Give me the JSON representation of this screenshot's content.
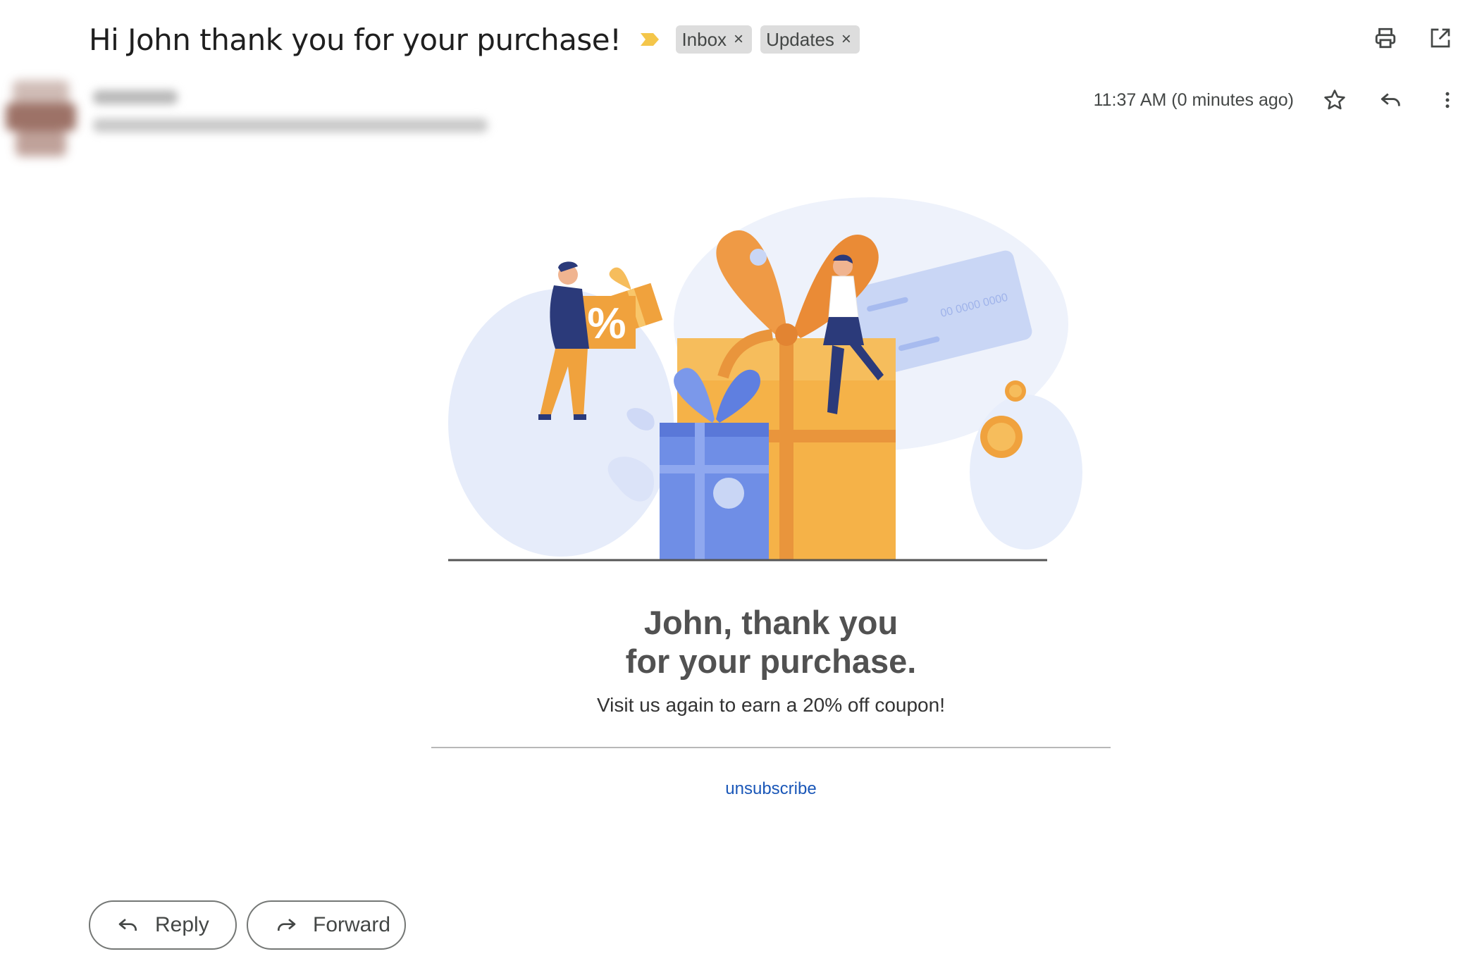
{
  "email": {
    "subject": "Hi John thank you for your purchase!",
    "labels": [
      {
        "name": "Inbox",
        "remove_glyph": "×"
      },
      {
        "name": "Updates",
        "remove_glyph": "×"
      }
    ],
    "timestamp": "11:37 AM (0 minutes ago)"
  },
  "icons": {
    "importance": "importance-marker-icon",
    "print": "print-icon",
    "open_new_window": "open-in-new-window-icon",
    "star": "star-icon",
    "reply": "reply-icon",
    "more": "more-vert-icon",
    "forward": "forward-icon"
  },
  "body": {
    "headline_line1": "John, thank you",
    "headline_line2": "for your purchase.",
    "subline": "Visit us again to earn a 20% off coupon!",
    "unsubscribe": "unsubscribe",
    "card_number": "00 0000 0000",
    "percent_sign": "%"
  },
  "actions": {
    "reply_label": "Reply",
    "forward_label": "Forward"
  },
  "colors": {
    "importance": "#f4c64a",
    "chip_bg": "#dddddd",
    "link": "#1a57b8",
    "orange": "#f0a23d",
    "blue": "#6f8ee6"
  }
}
